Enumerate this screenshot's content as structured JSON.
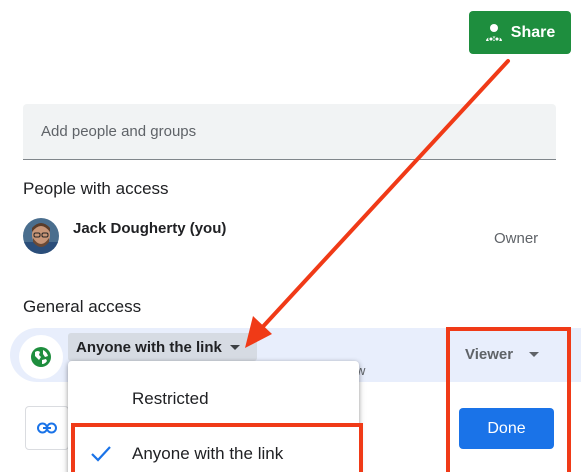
{
  "share_button": {
    "label": "Share",
    "icon": "person-add-icon",
    "color": "#1e8e3e"
  },
  "add_people": {
    "placeholder": "Add people and groups"
  },
  "people_with_access": {
    "title": "People with access",
    "people": [
      {
        "name": "Jack Dougherty (you)",
        "role": "Owner"
      }
    ]
  },
  "general_access": {
    "title": "General access",
    "selected_option": "Anyone with the link",
    "partial_description": "w",
    "role": "Viewer",
    "options": [
      {
        "label": "Restricted",
        "checked": false
      },
      {
        "label": "Anyone with the link",
        "checked": true
      }
    ]
  },
  "done_button": {
    "label": "Done",
    "color": "#1a73e8"
  },
  "copy_link": {
    "icon": "link-icon"
  },
  "annotation_color": "#f03a17"
}
